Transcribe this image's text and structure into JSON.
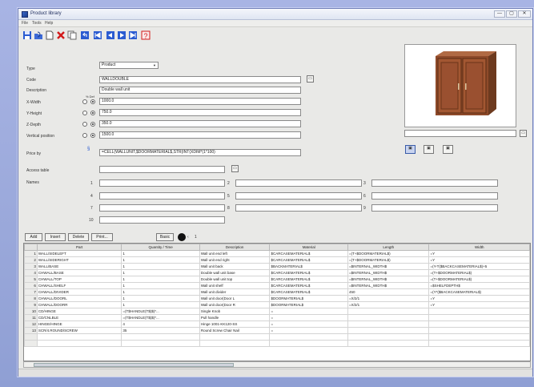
{
  "window": {
    "title": "Product library",
    "min_icon": "—",
    "max_icon": "▢",
    "close_icon": "✕"
  },
  "menu": [
    "File",
    "Tools",
    "Help"
  ],
  "toolbar": {
    "icons": [
      "save-icon",
      "open-icon",
      "new-icon",
      "delete-icon",
      "copy-icon",
      "undo-icon",
      "first-record-icon",
      "previous-record-icon",
      "next-record-icon",
      "last-record-icon",
      "help-icon"
    ],
    "colors": {
      "blue": "#2a5bd1",
      "red": "#d21a1a"
    }
  },
  "form": {
    "labels": {
      "type": "Type",
      "code": "Code",
      "description": "Description",
      "x_width": "X-Width",
      "y_height": "Y-Height",
      "z_depth": "Z-Depth",
      "vertical_position": "Vertical position",
      "price_by": "Price by",
      "access_table": "Access table",
      "names": "Names",
      "radio_header": "% Def"
    },
    "type_value": "Product",
    "code_value": "WALLDOUBLE",
    "description_value": "Double wall unit",
    "x_width_value": "1000.0",
    "y_height_value": "750.0",
    "z_depth_value": "350.0",
    "vertical_position_value": "1500.0",
    "price_by_value": "=CELL(WALLUNIT,$DOORMATERIAL$,STR(INT(XDIM*(1*100)",
    "access_table_value": "",
    "name_numbers": [
      "1",
      "2",
      "3",
      "4",
      "5",
      "6",
      "7",
      "8",
      "9",
      "10"
    ]
  },
  "preview_buttons": [
    "view-front-icon",
    "view-side-icon",
    "view-3d-icon"
  ],
  "grid_toolbar": {
    "add": "Add",
    "insert": "Insert",
    "delete": "Delete",
    "print": "Print...",
    "view": "Basic",
    "page_number": "1"
  },
  "grid": {
    "headers": [
      "",
      "Part",
      "Quantity / Time",
      "Description",
      "Material",
      "Length",
      "Width"
    ],
    "rows": [
      [
        "1",
        "WALL/SIDELEFT",
        "1",
        "Wall unit end left",
        "$CARCASEMATERIAL$",
        "=(T+$DOORMATERIAL$)",
        "=Y"
      ],
      [
        "2",
        "WALL/SIDERIGHT",
        "1",
        "Wall unit end right",
        "$CARCASEMATERIAL$",
        "=(T+$DOORMATERIAL$)",
        "=Y"
      ],
      [
        "3",
        "WALL/BASE",
        "1",
        "Wall unit back",
        "$BACKMATERIAL$",
        "=$INTERNAL_WIDTH$",
        "=(Y-T($BACKCASEMATERIAL$)+5"
      ],
      [
        "4",
        "CHWALL/BASE",
        "1",
        "Double wall unit base",
        "$CARCASEMATERIAL$",
        "=$INTERNAL_WIDTH$",
        "=(T+$DOORMATERIAL$)"
      ],
      [
        "5",
        "CHWALL/TOP",
        "1",
        "Double wall unit top",
        "$CARCASEMATERIAL$",
        "=$INTERNAL_WIDTH$",
        "=(T+$DOORMATERIAL$)"
      ],
      [
        "6",
        "CHWALL/SHELF",
        "1",
        "Wall unit shelf",
        "$CARCASEMATERIAL$",
        "=$INTERNAL_WIDTH$",
        "=$SHELFDEPTH$"
      ],
      [
        "7",
        "CHWALL/DIVIDER",
        "1",
        "Wall unit divider",
        "$CARCASEMATERIAL$",
        "450",
        "=(Y*($BACKCASEMATERIAL$)"
      ],
      [
        "8",
        "CHWALL/DOORL",
        "1",
        "Wall unit door(Door L",
        "$DOORMATERIAL$",
        "=X/2/1",
        "=Y"
      ],
      [
        "9",
        "CHWALL/DOORR",
        "1",
        "Wall unit door(Door R",
        "$DOORMATERIAL$",
        "=X/2/1",
        "=Y"
      ],
      [
        "10",
        "CD/HINGE",
        "=(T$HANDLE(T$)$)*...",
        "Single Knob",
        "=",
        "",
        ""
      ],
      [
        "11",
        "CD/CNLBLE",
        "=(T$HANDLE(T$)$)*...",
        "Pull handle",
        "=",
        "",
        ""
      ],
      [
        "12",
        "HINGE/HINGE",
        "4",
        "Hinge 1001-KK120-SS",
        "=",
        "",
        ""
      ],
      [
        "13",
        "SCR/4.ROUND/SCREW",
        "35",
        "Round Screw Chair Nail",
        "=",
        "",
        ""
      ]
    ]
  }
}
